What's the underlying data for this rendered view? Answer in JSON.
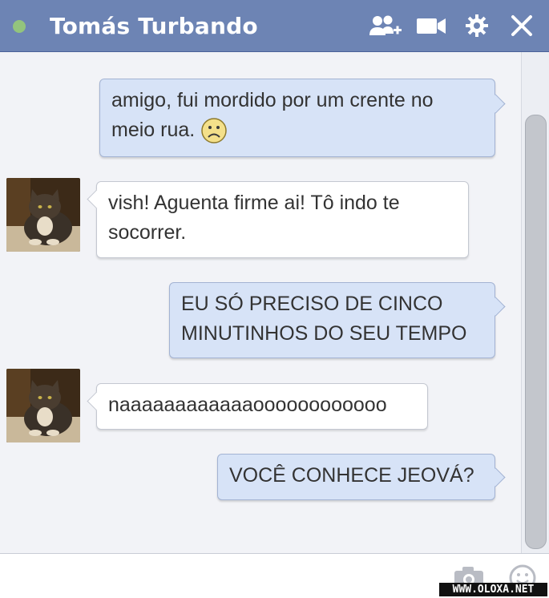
{
  "header": {
    "contact_name": "Tomás Turbando"
  },
  "messages": [
    {
      "from": "me",
      "lines": [
        "amigo, fui mordido por um crente no",
        "meio rua."
      ],
      "emoji": "frown-emoji"
    },
    {
      "from": "friend",
      "lines": [
        "vish! Aguenta firme ai! Tô indo te",
        "socorrer."
      ]
    },
    {
      "from": "me",
      "lines": [
        "EU SÓ PRECISO DE CINCO",
        "MINUTINHOS DO SEU TEMPO"
      ]
    },
    {
      "from": "friend",
      "lines": [
        "naaaaaaaaaaaaoooooooooooo"
      ]
    },
    {
      "from": "me",
      "lines": [
        "VOCÊ CONHECE JEOVÁ?"
      ]
    }
  ],
  "watermark": "WWW.OLOXA.NET",
  "colors": {
    "header": "#6d84b4",
    "online": "#93c47d",
    "bubble_out": "#d7e3f7",
    "bubble_in": "#ffffff"
  },
  "icons": [
    "add-friends-icon",
    "video-call-icon",
    "gear-icon",
    "close-icon",
    "camera-icon",
    "emoticon-icon"
  ]
}
